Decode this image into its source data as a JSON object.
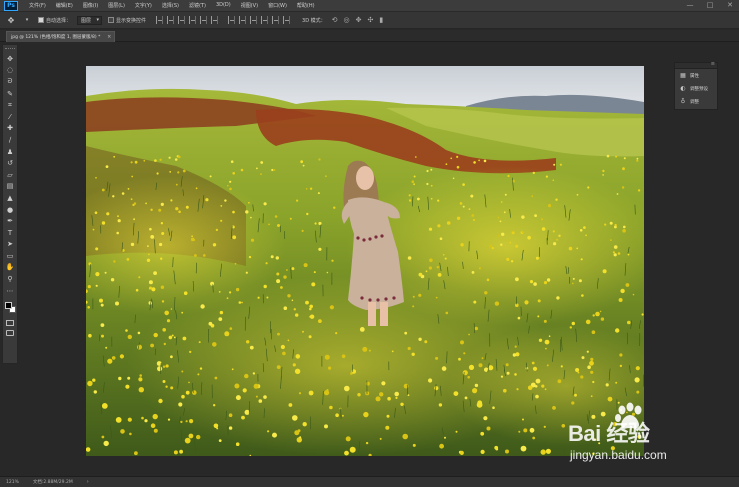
{
  "app": {
    "logo": "Ps"
  },
  "menu": [
    "文件(F)",
    "编辑(E)",
    "图像(I)",
    "图层(L)",
    "文字(Y)",
    "选择(S)",
    "滤镜(T)",
    "3D(D)",
    "视图(V)",
    "窗口(W)",
    "帮助(H)"
  ],
  "window_controls": {
    "minimize": "—",
    "maximize": "□",
    "close": "✕"
  },
  "options": {
    "auto_select_label": "自动选择：",
    "auto_select_checked": true,
    "auto_select_target": "图层",
    "show_transform_label": "显示变换控件",
    "show_transform_checked": false,
    "mode_3d_label": "3D 模式："
  },
  "document_tab": {
    "title": "jpg @ 121% (色相/饱和度 1, 图层蒙版/8) *",
    "close": "×"
  },
  "tools": [
    {
      "name": "move-tool",
      "glyph": "✥"
    },
    {
      "name": "marquee-tool",
      "glyph": "◌"
    },
    {
      "name": "lasso-tool",
      "glyph": "ᘐ"
    },
    {
      "name": "quick-select-tool",
      "glyph": "✎"
    },
    {
      "name": "crop-tool",
      "glyph": "⌗"
    },
    {
      "name": "eyedropper-tool",
      "glyph": "⁄"
    },
    {
      "name": "healing-brush-tool",
      "glyph": "✚"
    },
    {
      "name": "brush-tool",
      "glyph": "∕"
    },
    {
      "name": "clone-stamp-tool",
      "glyph": "♟"
    },
    {
      "name": "history-brush-tool",
      "glyph": "↺"
    },
    {
      "name": "eraser-tool",
      "glyph": "▱"
    },
    {
      "name": "gradient-tool",
      "glyph": "▤"
    },
    {
      "name": "blur-tool",
      "glyph": "▲"
    },
    {
      "name": "dodge-tool",
      "glyph": "●"
    },
    {
      "name": "pen-tool",
      "glyph": "✒"
    },
    {
      "name": "type-tool",
      "glyph": "T"
    },
    {
      "name": "path-select-tool",
      "glyph": "➤"
    },
    {
      "name": "shape-tool",
      "glyph": "▭"
    },
    {
      "name": "hand-tool",
      "glyph": "✋"
    },
    {
      "name": "zoom-tool",
      "glyph": "⚲"
    },
    {
      "name": "more-tools",
      "glyph": "⋯"
    }
  ],
  "colors": {
    "foreground": "#000000",
    "background": "#ffffff",
    "ui_bg": "#282828",
    "panel": "#3a3a3a"
  },
  "right_panel": [
    {
      "icon": "properties-icon",
      "glyph": "▦",
      "label": "属性"
    },
    {
      "icon": "adjustments-icon",
      "glyph": "◐",
      "label": "调整预设"
    },
    {
      "icon": "lightbulb-icon",
      "glyph": "♁",
      "label": "调整"
    }
  ],
  "status": {
    "zoom": "121%",
    "doc_info": "文档:2.88M/29.2M",
    "arrow": "›"
  },
  "watermark": {
    "brand": "Bai  经验",
    "url": "jingyan.baidu.com"
  }
}
